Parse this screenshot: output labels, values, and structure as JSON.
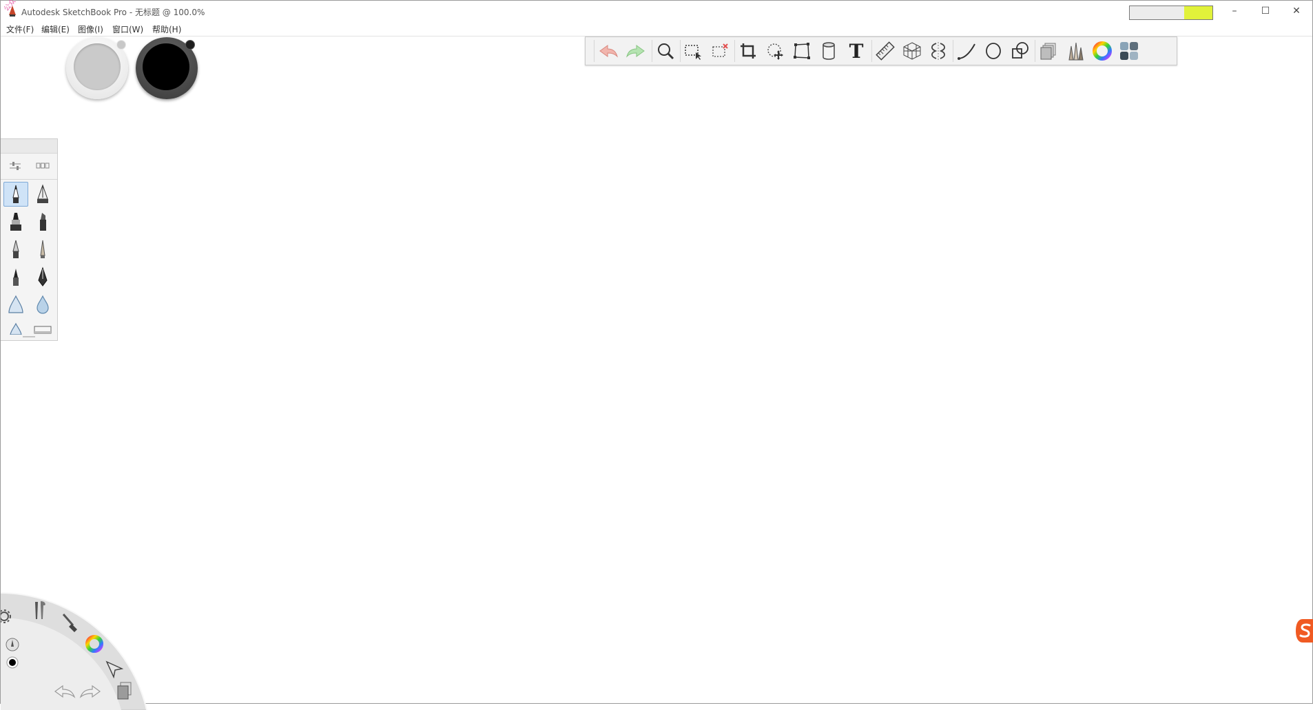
{
  "window": {
    "title": "Autodesk SketchBook Pro - 无标题 @ 100.0%",
    "minimize_glyph": "–",
    "maximize_glyph": "☐",
    "close_glyph": "✕"
  },
  "watermark": "公众号 软件科技",
  "menu": {
    "items": [
      {
        "label": "文件(F)"
      },
      {
        "label": "编辑(E)"
      },
      {
        "label": "图像(I)"
      },
      {
        "label": "窗口(W)"
      },
      {
        "label": "帮助(H)"
      }
    ]
  },
  "colors": {
    "secondary_puck": "#cacaca",
    "primary_puck": "#000000",
    "swatch_gray": "#ececec",
    "swatch_yellow": "#e1f23a",
    "accent_selected": "#cfe3f7"
  },
  "toolbar": {
    "text_tool_glyph": "T",
    "tools": [
      {
        "icon": "undo-icon"
      },
      {
        "icon": "redo-icon"
      },
      {
        "icon": "zoom-icon"
      },
      {
        "icon": "rect-select-icon"
      },
      {
        "icon": "select-remove-icon"
      },
      {
        "icon": "crop-icon"
      },
      {
        "icon": "move-rotate-icon"
      },
      {
        "icon": "distort-icon"
      },
      {
        "icon": "fill-bucket-icon"
      },
      {
        "icon": "text-icon"
      },
      {
        "icon": "ruler-icon"
      },
      {
        "icon": "perspective-grid-icon"
      },
      {
        "icon": "symmetry-icon"
      },
      {
        "icon": "stroke-curve-icon"
      },
      {
        "icon": "ellipse-icon"
      },
      {
        "icon": "shapes-icon"
      },
      {
        "icon": "layers-icon"
      },
      {
        "icon": "brush-library-icon"
      },
      {
        "icon": "color-wheel-icon"
      },
      {
        "icon": "copic-swatches-icon"
      }
    ]
  },
  "brush_panel": {
    "tabs": [
      {
        "icon": "brush-properties-icon"
      },
      {
        "icon": "brush-library-icon"
      }
    ],
    "brushes": [
      {
        "icon": "pencil-brush-icon",
        "selected": true
      },
      {
        "icon": "ink-pen-brush-icon"
      },
      {
        "icon": "marker-brush-icon"
      },
      {
        "icon": "chisel-marker-icon"
      },
      {
        "icon": "ballpoint-pen-icon"
      },
      {
        "icon": "fine-pencil-icon"
      },
      {
        "icon": "felt-pen-icon"
      },
      {
        "icon": "fountain-pen-icon"
      },
      {
        "icon": "airbrush-icon"
      },
      {
        "icon": "blur-drop-icon"
      },
      {
        "icon": "soft-brush-icon"
      },
      {
        "icon": "eraser-icon"
      }
    ]
  },
  "lagoon": {
    "tools": [
      {
        "icon": "settings-icon"
      },
      {
        "icon": "tools-icon"
      },
      {
        "icon": "brush-icon"
      },
      {
        "icon": "color-wheel-icon"
      },
      {
        "icon": "pen-size-icon"
      },
      {
        "icon": "color-dot-icon"
      },
      {
        "icon": "select-arrow-icon"
      },
      {
        "icon": "undo-icon"
      },
      {
        "icon": "redo-icon"
      },
      {
        "icon": "layers-icon"
      }
    ]
  }
}
